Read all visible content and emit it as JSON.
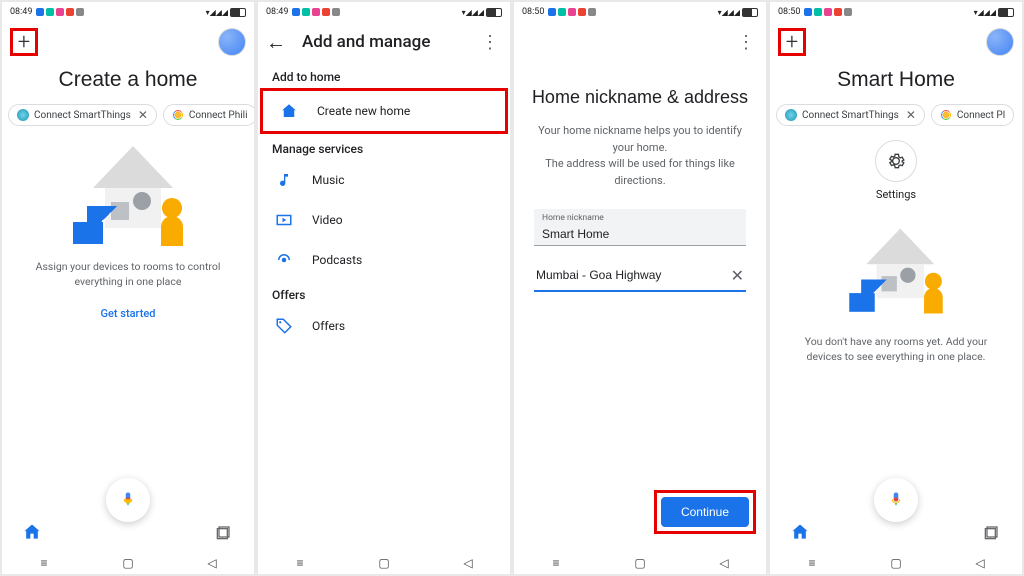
{
  "status": {
    "time1": "08:49",
    "time2": "08:50"
  },
  "screen1": {
    "title": "Create a home",
    "chip1": "Connect SmartThings",
    "chip2": "Connect Phili",
    "desc": "Assign your devices to rooms to control everything in one place",
    "cta": "Get started"
  },
  "screen2": {
    "title": "Add and manage",
    "sec1": "Add to home",
    "item1": "Create new home",
    "sec2": "Manage services",
    "item2": "Music",
    "item3": "Video",
    "item4": "Podcasts",
    "sec3": "Offers",
    "item5": "Offers"
  },
  "screen3": {
    "title": "Home nickname & address",
    "desc": "Your home nickname helps you to identify your home.\nThe address will be used for things like directions.",
    "nick_label": "Home nickname",
    "nick_value": "Smart Home",
    "address_value": "Mumbai - Goa Highway",
    "continue": "Continue"
  },
  "screen4": {
    "title": "Smart Home",
    "chip1": "Connect SmartThings",
    "chip2": "Connect Pl",
    "settings": "Settings",
    "desc": "You don't have any rooms yet. Add your devices to see everything in one place."
  }
}
